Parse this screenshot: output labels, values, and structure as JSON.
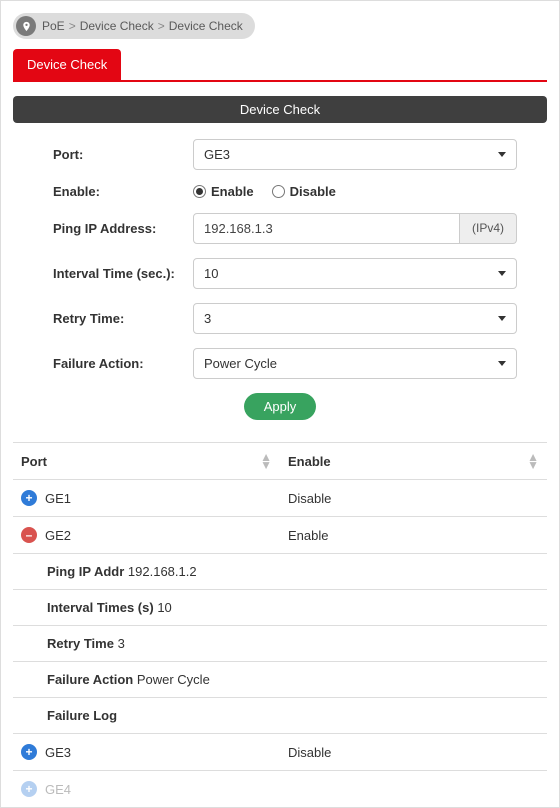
{
  "breadcrumb": {
    "a": "PoE",
    "b": "Device Check",
    "c": "Device Check"
  },
  "tab": {
    "label": "Device Check"
  },
  "panel": {
    "title": "Device Check"
  },
  "form": {
    "port_label": "Port:",
    "port_value": "GE3",
    "enable_label": "Enable:",
    "enable_opt_on": "Enable",
    "enable_opt_off": "Disable",
    "ip_label": "Ping IP Address:",
    "ip_value": "192.168.1.3",
    "ip_addon": "(IPv4)",
    "interval_label": "Interval Time (sec.):",
    "interval_value": "10",
    "retry_label": "Retry Time:",
    "retry_value": "3",
    "failure_label": "Failure Action:",
    "failure_value": "Power Cycle",
    "apply": "Apply"
  },
  "table": {
    "col_port": "Port",
    "col_enable": "Enable",
    "rows": [
      {
        "name": "GE1",
        "enable": "Disable"
      },
      {
        "name": "GE2",
        "enable": "Enable"
      },
      {
        "name": "GE3",
        "enable": "Disable"
      },
      {
        "name": "GE4",
        "enable": ""
      }
    ],
    "details": {
      "ip_label": "Ping IP Addr",
      "ip_value": "192.168.1.2",
      "interval_label": "Interval Times (s)",
      "interval_value": "10",
      "retry_label": "Retry Time",
      "retry_value": "3",
      "failure_label": "Failure Action",
      "failure_value": "Power Cycle",
      "log_label": "Failure Log"
    }
  }
}
